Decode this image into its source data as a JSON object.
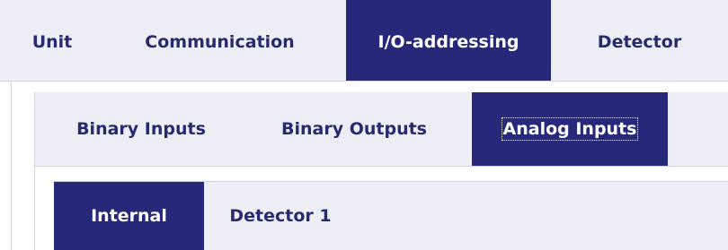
{
  "tabs_level1": {
    "items": [
      "Unit",
      "Communication",
      "I/O-addressing",
      "Detector"
    ],
    "active": "I/O-addressing"
  },
  "tabs_level2": {
    "items": [
      "Binary Inputs",
      "Binary Outputs",
      "Analog Inputs"
    ],
    "active": "Analog Inputs"
  },
  "tabs_level3": {
    "items": [
      "Internal",
      "Detector 1"
    ],
    "active": "Internal"
  },
  "colors": {
    "active_tab_bg": "#26297a",
    "tab_bar_bg": "#eeeef6",
    "tab_text": "#262b6e",
    "active_tab_text": "#ffffff"
  }
}
